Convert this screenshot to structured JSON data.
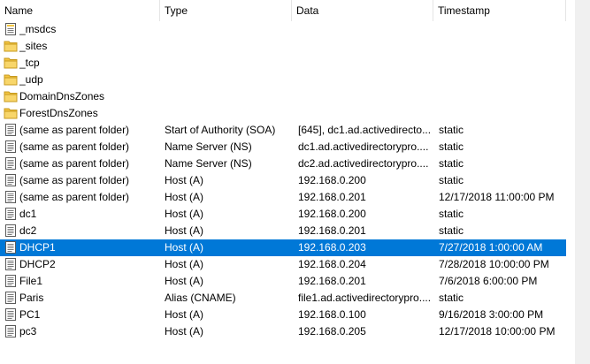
{
  "columns": {
    "name": "Name",
    "type": "Type",
    "data": "Data",
    "timestamp": "Timestamp"
  },
  "records": [
    {
      "icon": "folder-record-icon",
      "name": "_msdcs",
      "type": "",
      "data": "",
      "timestamp": ""
    },
    {
      "icon": "folder-icon",
      "name": "_sites",
      "type": "",
      "data": "",
      "timestamp": ""
    },
    {
      "icon": "folder-icon",
      "name": "_tcp",
      "type": "",
      "data": "",
      "timestamp": ""
    },
    {
      "icon": "folder-icon",
      "name": "_udp",
      "type": "",
      "data": "",
      "timestamp": ""
    },
    {
      "icon": "folder-icon",
      "name": "DomainDnsZones",
      "type": "",
      "data": "",
      "timestamp": ""
    },
    {
      "icon": "folder-icon",
      "name": "ForestDnsZones",
      "type": "",
      "data": "",
      "timestamp": ""
    },
    {
      "icon": "record-icon",
      "name": "(same as parent folder)",
      "type": "Start of Authority (SOA)",
      "data": "[645], dc1.ad.activedirecto...",
      "timestamp": "static"
    },
    {
      "icon": "record-icon",
      "name": "(same as parent folder)",
      "type": "Name Server (NS)",
      "data": "dc1.ad.activedirectorypro....",
      "timestamp": "static"
    },
    {
      "icon": "record-icon",
      "name": "(same as parent folder)",
      "type": "Name Server (NS)",
      "data": "dc2.ad.activedirectorypro....",
      "timestamp": "static"
    },
    {
      "icon": "record-icon",
      "name": "(same as parent folder)",
      "type": "Host (A)",
      "data": "192.168.0.200",
      "timestamp": "static"
    },
    {
      "icon": "record-icon",
      "name": "(same as parent folder)",
      "type": "Host (A)",
      "data": "192.168.0.201",
      "timestamp": "12/17/2018 11:00:00 PM"
    },
    {
      "icon": "record-icon",
      "name": "dc1",
      "type": "Host (A)",
      "data": "192.168.0.200",
      "timestamp": "static"
    },
    {
      "icon": "record-icon",
      "name": "dc2",
      "type": "Host (A)",
      "data": "192.168.0.201",
      "timestamp": "static"
    },
    {
      "icon": "record-icon",
      "name": "DHCP1",
      "type": "Host (A)",
      "data": "192.168.0.203",
      "timestamp": "7/27/2018 1:00:00 AM",
      "selected": true
    },
    {
      "icon": "record-icon",
      "name": "DHCP2",
      "type": "Host (A)",
      "data": "192.168.0.204",
      "timestamp": "7/28/2018 10:00:00 PM"
    },
    {
      "icon": "record-icon",
      "name": "File1",
      "type": "Host (A)",
      "data": "192.168.0.201",
      "timestamp": "7/6/2018 6:00:00 PM"
    },
    {
      "icon": "record-icon",
      "name": "Paris",
      "type": "Alias (CNAME)",
      "data": "file1.ad.activedirectorypro....",
      "timestamp": "static"
    },
    {
      "icon": "record-icon",
      "name": "PC1",
      "type": "Host (A)",
      "data": "192.168.0.100",
      "timestamp": "9/16/2018 3:00:00 PM"
    },
    {
      "icon": "record-icon",
      "name": "pc3",
      "type": "Host (A)",
      "data": "192.168.0.205",
      "timestamp": "12/17/2018 10:00:00 PM"
    }
  ],
  "colors": {
    "selection": "#0078d7",
    "folder": "#f4c542",
    "header_separator": "#e5e5e5"
  }
}
